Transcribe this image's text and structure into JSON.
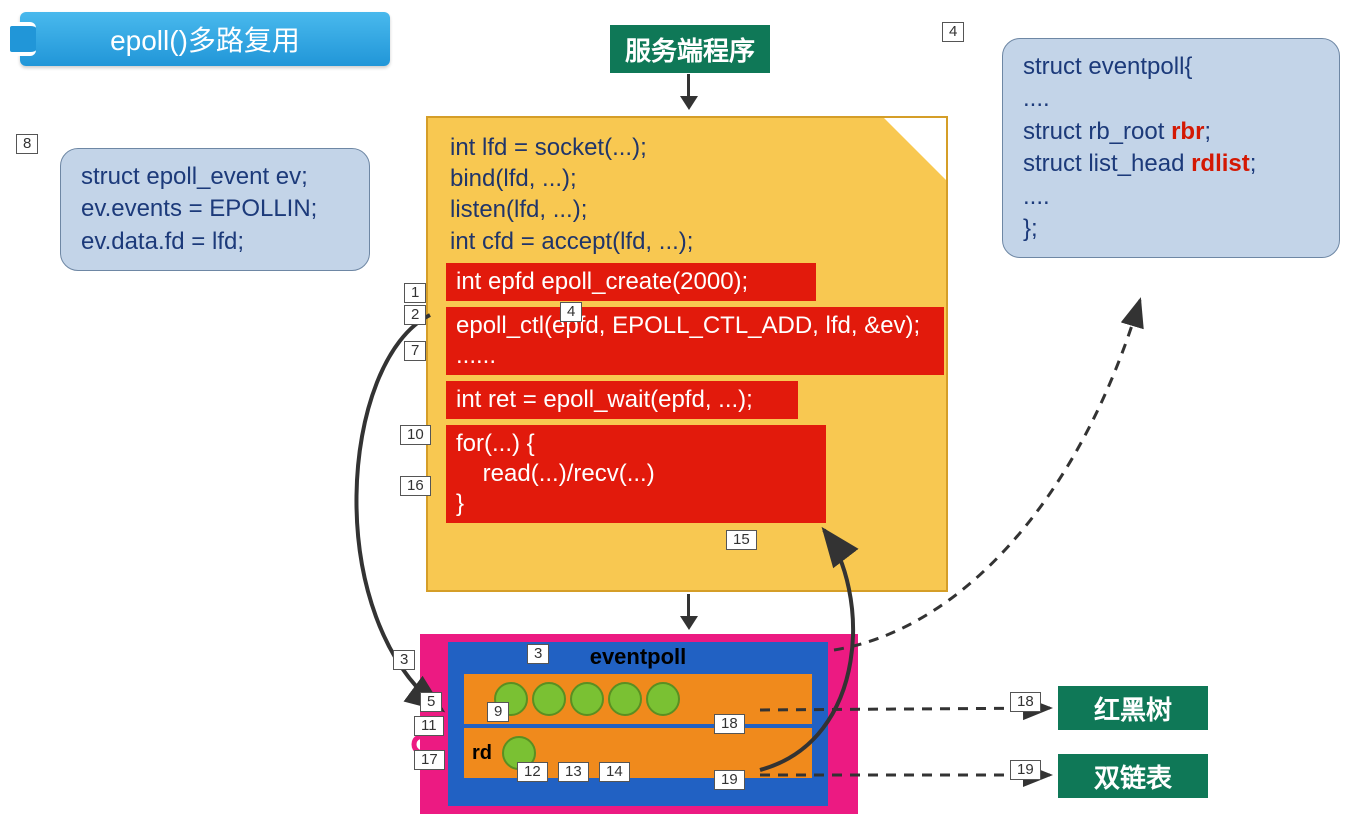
{
  "title": "epoll()多路复用",
  "numbers": {
    "n8": "8",
    "n4a": "4",
    "n1": "1",
    "n2": "2",
    "n4b": "4",
    "n7": "7",
    "n10": "10",
    "n16": "16",
    "n15": "15",
    "n3a": "3",
    "n3b": "3",
    "n5": "5",
    "n9": "9",
    "n18a": "18",
    "n11": "11",
    "n12": "12",
    "n13": "13",
    "n14": "14",
    "n17": "17",
    "n19": "19",
    "n18b": "18",
    "n19b": "19"
  },
  "leftBox": {
    "l1": "struct epoll_event ev;",
    "l2": "ev.events = EPOLLIN;",
    "l3": "ev.data.fd = lfd;"
  },
  "rightBox": {
    "l1": "struct eventpoll{",
    "l2": "....",
    "l3a": "struct rb_root ",
    "l3b": "rbr",
    "l3c": ";",
    "l4a": "struct list_head ",
    "l4b": "rdlist",
    "l4c": ";",
    "l5": "....",
    "l6": "};"
  },
  "serverLabel": "服务端程序",
  "code": {
    "c1": "int lfd = socket(...);",
    "c2": "bind(lfd, ...);",
    "c3": "listen(lfd, ...);",
    "c4": "int cfd = accept(lfd, ...);",
    "r1": "int epfd     epoll_create(2000);",
    "r2a": "epoll_ctl(epfd, EPOLL_CTL_ADD, lfd, &ev);",
    "r2b": "......",
    "r3": "int ret = epoll_wait(epfd, ...);",
    "r4a": "for(...) {",
    "r4b": "    read(...)/recv(...)",
    "r4c": "}"
  },
  "eventpoll": {
    "title": "eventpoll",
    "row2": "rd"
  },
  "teal": {
    "rbtree": "红黑树",
    "dlist": "双链表"
  }
}
